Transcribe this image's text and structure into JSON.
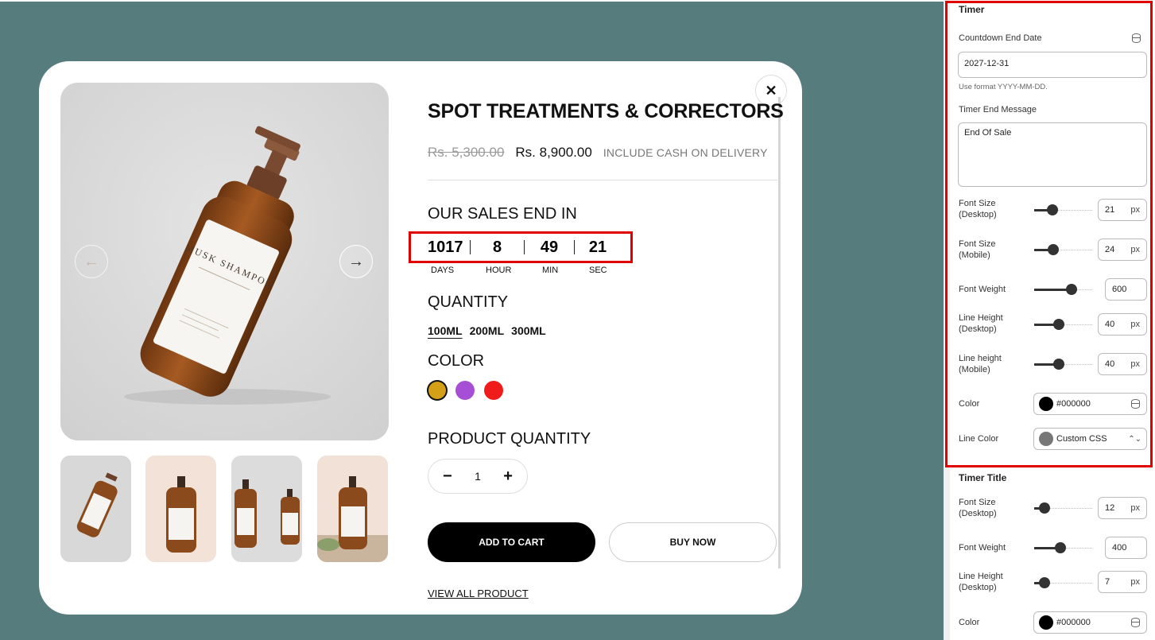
{
  "product": {
    "title": "SPOT TREATMENTS & CORRECTORS",
    "old_price": "Rs. 5,300.00",
    "new_price": "Rs. 8,900.00",
    "price_note": "INCLUDE CASH ON DELIVERY",
    "image_brand_text": "MUSK SHAMPOO",
    "close_glyph": "✕",
    "prev_glyph": "←",
    "next_glyph": "→"
  },
  "countdown": {
    "heading": "OUR SALES END IN",
    "days": "1017",
    "hours": "8",
    "minutes": "49",
    "seconds": "21",
    "labels": {
      "days": "DAYS",
      "hours": "HOUR",
      "minutes": "MIN",
      "seconds": "SEC"
    }
  },
  "quantity_section": {
    "heading": "QUANTITY",
    "variants": [
      "100ML",
      "200ML",
      "300ML"
    ]
  },
  "color_section": {
    "heading": "COLOR",
    "swatches": [
      "#d4a017",
      "#a64fd6",
      "#f01c1c"
    ]
  },
  "product_quantity": {
    "heading": "PRODUCT QUANTITY",
    "minus": "−",
    "value": "1",
    "plus": "+"
  },
  "actions": {
    "add_to_cart": "ADD TO CART",
    "buy_now": "BUY NOW",
    "view_all": "VIEW ALL PRODUCT"
  },
  "timer_settings": {
    "heading": "Timer",
    "end_date_label": "Countdown End Date",
    "end_date_value": "2027-12-31",
    "end_date_help": "Use format YYYY-MM-DD.",
    "end_message_label": "Timer End Message",
    "end_message_value": "End Of Sale",
    "font_size_desktop": {
      "label1": "Font Size",
      "label2": "(Desktop)",
      "value": "21",
      "unit": "px"
    },
    "font_size_mobile": {
      "label1": "Font Size",
      "label2": "(Mobile)",
      "value": "24",
      "unit": "px"
    },
    "font_weight": {
      "label": "Font Weight",
      "value": "600"
    },
    "line_height_desktop": {
      "label1": "Line Height",
      "label2": "(Desktop)",
      "value": "40",
      "unit": "px"
    },
    "line_height_mobile": {
      "label1": "Line height",
      "label2": "(Mobile)",
      "value": "40",
      "unit": "px"
    },
    "color": {
      "label": "Color",
      "value": "#000000",
      "swatch": "#000000"
    },
    "line_color": {
      "label": "Line Color",
      "value": "Custom CSS",
      "swatch": "#777777"
    }
  },
  "timer_title_settings": {
    "heading": "Timer Title",
    "font_size_desktop": {
      "label1": "Font Size",
      "label2": "(Desktop)",
      "value": "12",
      "unit": "px"
    },
    "font_weight": {
      "label": "Font Weight",
      "value": "400"
    },
    "line_height_desktop": {
      "label1": "Line Height",
      "label2": "(Desktop)",
      "value": "7",
      "unit": "px"
    },
    "color": {
      "label": "Color",
      "value": "#000000",
      "swatch": "#000000"
    }
  },
  "slider_levels": {
    "timer_font_size_desktop": 0.27,
    "timer_font_size_mobile": 0.29,
    "timer_font_weight": 0.68,
    "timer_line_height_desktop": 0.41,
    "timer_line_height_mobile": 0.41,
    "title_font_size_desktop": 0.1,
    "title_font_weight": 0.44,
    "title_line_height_desktop": 0.1
  }
}
